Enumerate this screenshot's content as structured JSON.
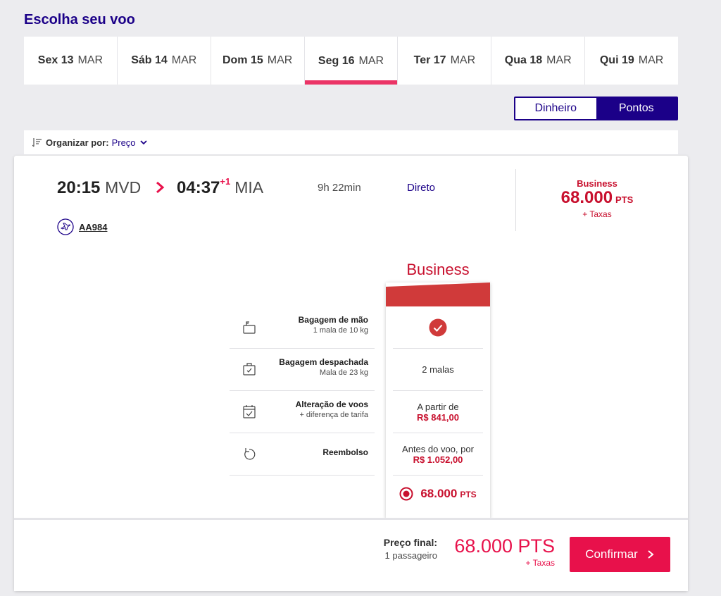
{
  "page": {
    "title": "Escolha seu voo"
  },
  "date_tabs": [
    {
      "day": "Sex 13",
      "month": "MAR",
      "active": false
    },
    {
      "day": "Sáb 14",
      "month": "MAR",
      "active": false
    },
    {
      "day": "Dom 15",
      "month": "MAR",
      "active": false
    },
    {
      "day": "Seg 16",
      "month": "MAR",
      "active": true
    },
    {
      "day": "Ter 17",
      "month": "MAR",
      "active": false
    },
    {
      "day": "Qua 18",
      "month": "MAR",
      "active": false
    },
    {
      "day": "Qui 19",
      "month": "MAR",
      "active": false
    }
  ],
  "currency": {
    "money_label": "Dinheiro",
    "points_label": "Pontos",
    "selected": "Pontos"
  },
  "sort": {
    "label": "Organizar por:",
    "value": "Preço"
  },
  "flight": {
    "departure_time": "20:15",
    "departure_code": "MVD",
    "arrival_time": "04:37",
    "arrival_day_offset": "+1",
    "arrival_code": "MIA",
    "duration": "9h 22min",
    "stops": "Direto",
    "flight_number": "AA984",
    "summary": {
      "cabin": "Business",
      "price": "68.000",
      "unit": "PTS",
      "taxes": "+ Taxas"
    }
  },
  "fare": {
    "name": "Business",
    "features": [
      {
        "title": "Bagagem de mão",
        "subtitle": "1 mala de 10 kg",
        "icon": "carry-on-bag-icon",
        "value": "",
        "value_price": "",
        "included": true
      },
      {
        "title": "Bagagem despachada",
        "subtitle": "Mala de 23 kg",
        "icon": "checked-bag-icon",
        "value": "2 malas",
        "value_price": ""
      },
      {
        "title": "Alteração de voos",
        "subtitle": "+ diferença de tarifa",
        "icon": "calendar-check-icon",
        "value": "A partir de",
        "value_price": "R$ 841,00"
      },
      {
        "title": "Reembolso",
        "subtitle": "",
        "icon": "refund-icon",
        "value": "Antes do voo, por",
        "value_price": "R$ 1.052,00"
      }
    ],
    "select_price": "68.000",
    "select_unit": "PTS"
  },
  "footer": {
    "final_label": "Preço final:",
    "passengers": "1 passageiro",
    "total": "68.000 PTS",
    "taxes": "+ Taxas",
    "confirm_label": "Confirmar"
  },
  "colors": {
    "brand_navy": "#1b0088",
    "accent_red": "#e8114b",
    "fare_red": "#c8102e"
  }
}
